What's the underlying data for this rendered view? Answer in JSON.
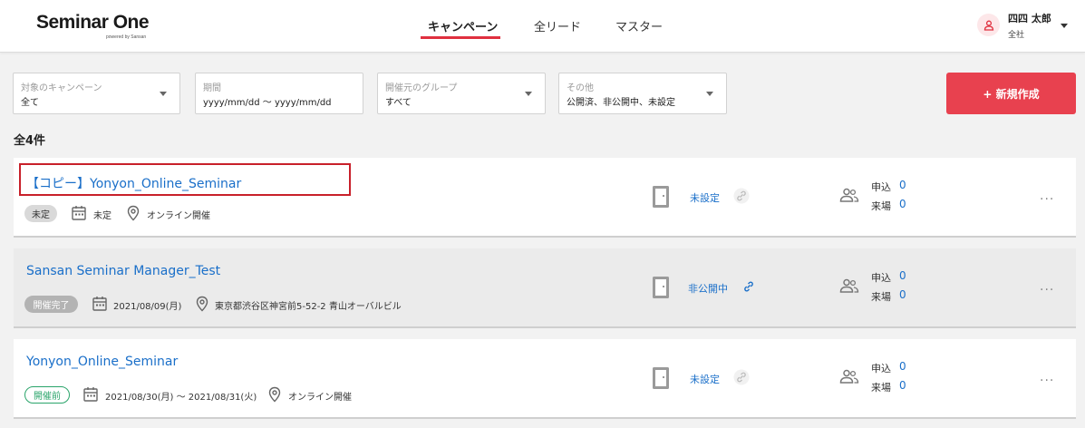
{
  "header": {
    "logo_main": "Seminar One",
    "logo_sub": "powered by Sansan",
    "nav": [
      "キャンペーン",
      "全リード",
      "マスター"
    ],
    "user_name": "四四 太郎",
    "user_org": "全社"
  },
  "filters": [
    {
      "label": "対象のキャンペーン",
      "value": "全て"
    },
    {
      "label": "期間",
      "value": "yyyy/mm/dd 〜 yyyy/mm/dd"
    },
    {
      "label": "開催元のグループ",
      "value": "すべて"
    },
    {
      "label": "その他",
      "value": "公開済、非公開中、未設定"
    }
  ],
  "new_button": "+ 新規作成",
  "total": "全4件",
  "campaigns": [
    {
      "title": "【コピー】Yonyon_Online_Seminar",
      "badge": "未定",
      "date": "未定",
      "location": "オンライン開催",
      "status": "未設定",
      "apply_label": "申込",
      "apply": "0",
      "visit_label": "来場",
      "visit": "0",
      "more": "···"
    },
    {
      "title": "Sansan Seminar Manager_Test",
      "badge": "開催完了",
      "date": "2021/08/09(月)",
      "location": "東京都渋谷区神宮前5-52-2 青山オーバルビル",
      "status": "非公開中",
      "apply_label": "申込",
      "apply": "0",
      "visit_label": "来場",
      "visit": "0",
      "more": "···"
    },
    {
      "title": "Yonyon_Online_Seminar",
      "badge": "開催前",
      "date": "2021/08/30(月) 〜 2021/08/31(火)",
      "location": "オンライン開催",
      "status": "未設定",
      "apply_label": "申込",
      "apply": "0",
      "visit_label": "来場",
      "visit": "0",
      "more": "···"
    }
  ],
  "colors": {
    "accent": "#e8414f",
    "link": "#1a6fc9",
    "nav_underline": "#e0303f"
  }
}
